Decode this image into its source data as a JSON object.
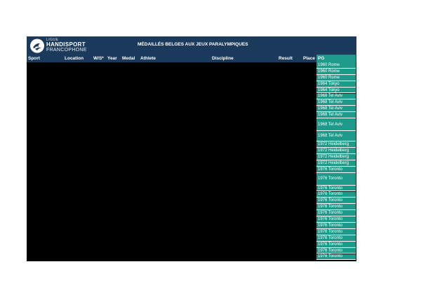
{
  "banner": {
    "brand_line1": "LIGUE",
    "brand_line2": "HANDISPORT",
    "brand_line3": "FRANCOPHONE",
    "title": "MÉDAILLÉS BELGES AUX JEUX PARALYMPIQUES"
  },
  "columns": {
    "sport": "Sport",
    "location": "Location",
    "ws": "W/S*",
    "year": "Year",
    "medal": "Medal",
    "athlete": "Athlete",
    "discipline": "Discipline",
    "result": "Result",
    "place": "Place",
    "pg": "PG"
  },
  "pg_values": [
    "1960 Rome",
    "1960 Rome",
    "1960 Rome",
    "1964 Tokyo",
    "1964 Tokyo",
    "1968 Tel Aviv",
    "1968 Tel Aviv",
    "1968 Tel Aviv",
    "1968 Tel Aviv",
    "1968 Tel Aviv",
    "1968 Tel Aviv",
    "1972 Heidelberg",
    "1972 Heidelberg",
    "1972 Heidelberg",
    "1972 Heidelberg",
    "1976 Toronto",
    "1976 Toronto",
    "1976 Toronto",
    "1976 Toronto",
    "1976 Toronto",
    "1976 Toronto",
    "1976 Toronto",
    "1976 Toronto",
    "1976 Toronto",
    "1976 Toronto",
    "1976 Toronto",
    "1976 Toronto",
    "1976 Toronto",
    "1976 Toronto"
  ],
  "colors": {
    "header_navy": "#1c3a5c",
    "pg_teal": "#1e9a8a",
    "body_black": "#000000"
  }
}
